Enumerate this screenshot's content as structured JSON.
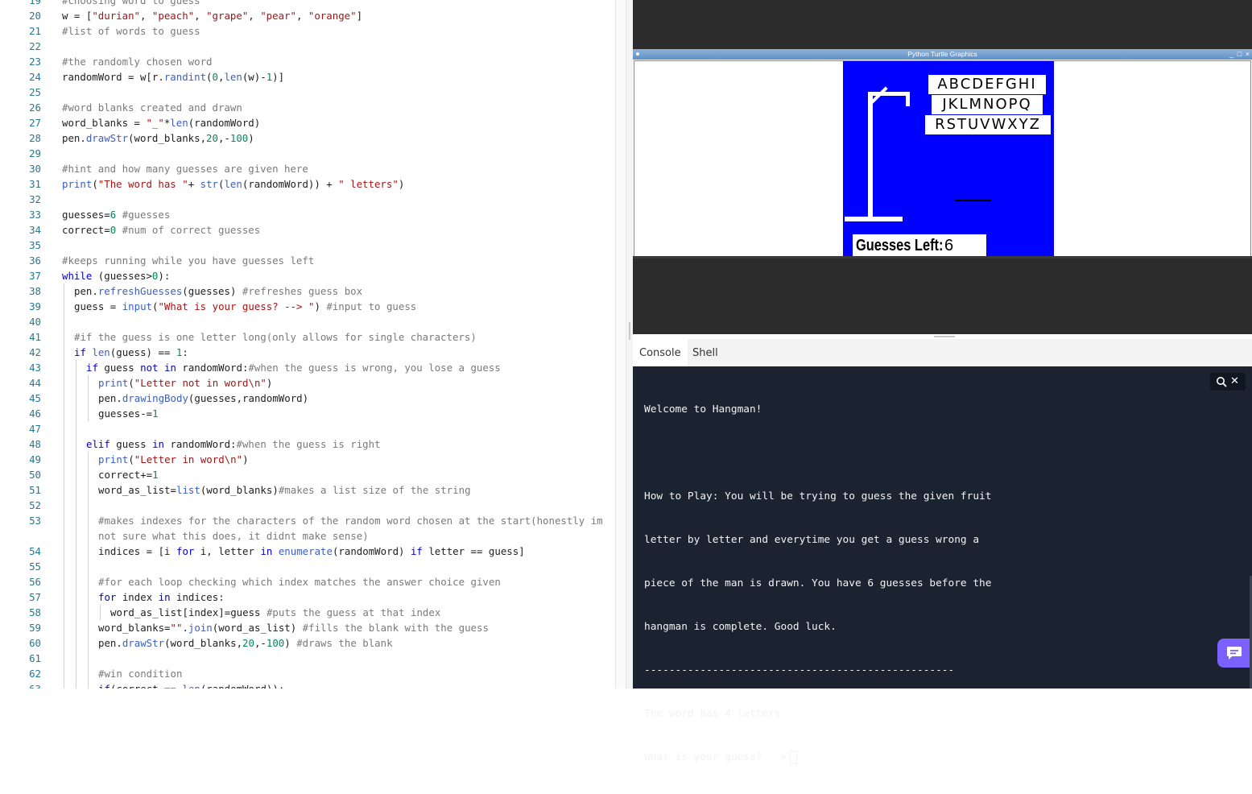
{
  "editor": {
    "lines": [
      {
        "num": "19",
        "indent": 0,
        "tokens": [
          {
            "t": "c",
            "v": "#choosing word to guess"
          }
        ]
      },
      {
        "num": "20",
        "indent": 0,
        "tokens": [
          {
            "t": "p",
            "v": "w = ["
          },
          {
            "t": "s",
            "v": "\"durian\""
          },
          {
            "t": "p",
            "v": ", "
          },
          {
            "t": "s",
            "v": "\"peach\""
          },
          {
            "t": "p",
            "v": ", "
          },
          {
            "t": "s",
            "v": "\"grape\""
          },
          {
            "t": "p",
            "v": ", "
          },
          {
            "t": "s",
            "v": "\"pear\""
          },
          {
            "t": "p",
            "v": ", "
          },
          {
            "t": "s",
            "v": "\"orange\""
          },
          {
            "t": "p",
            "v": "]"
          }
        ]
      },
      {
        "num": "21",
        "indent": 0,
        "tokens": [
          {
            "t": "c",
            "v": "#list of words to guess"
          }
        ]
      },
      {
        "num": "22",
        "indent": 0,
        "tokens": []
      },
      {
        "num": "23",
        "indent": 0,
        "tokens": [
          {
            "t": "c",
            "v": "#the randomly chosen word"
          }
        ]
      },
      {
        "num": "24",
        "indent": 0,
        "tokens": [
          {
            "t": "p",
            "v": "randomWord = w[r."
          },
          {
            "t": "b",
            "v": "randint"
          },
          {
            "t": "p",
            "v": "("
          },
          {
            "t": "n",
            "v": "0"
          },
          {
            "t": "p",
            "v": ","
          },
          {
            "t": "b",
            "v": "len"
          },
          {
            "t": "p",
            "v": "(w)-"
          },
          {
            "t": "n",
            "v": "1"
          },
          {
            "t": "p",
            "v": ")]"
          }
        ]
      },
      {
        "num": "25",
        "indent": 0,
        "tokens": []
      },
      {
        "num": "26",
        "indent": 0,
        "tokens": [
          {
            "t": "c",
            "v": "#word blanks created and drawn"
          }
        ]
      },
      {
        "num": "27",
        "indent": 0,
        "tokens": [
          {
            "t": "p",
            "v": "word_blanks = "
          },
          {
            "t": "s",
            "v": "\"_\""
          },
          {
            "t": "p",
            "v": "*"
          },
          {
            "t": "b",
            "v": "len"
          },
          {
            "t": "p",
            "v": "(randomWord)"
          }
        ]
      },
      {
        "num": "28",
        "indent": 0,
        "tokens": [
          {
            "t": "p",
            "v": "pen."
          },
          {
            "t": "b",
            "v": "drawStr"
          },
          {
            "t": "p",
            "v": "(word_blanks,"
          },
          {
            "t": "n",
            "v": "20"
          },
          {
            "t": "p",
            "v": ",-"
          },
          {
            "t": "n",
            "v": "100"
          },
          {
            "t": "p",
            "v": ")"
          }
        ]
      },
      {
        "num": "29",
        "indent": 0,
        "tokens": []
      },
      {
        "num": "30",
        "indent": 0,
        "tokens": [
          {
            "t": "c",
            "v": "#hint and how many guesses are given here"
          }
        ]
      },
      {
        "num": "31",
        "indent": 0,
        "tokens": [
          {
            "t": "b",
            "v": "print"
          },
          {
            "t": "p",
            "v": "("
          },
          {
            "t": "s",
            "v": "\"The word has \""
          },
          {
            "t": "p",
            "v": "+ "
          },
          {
            "t": "b",
            "v": "str"
          },
          {
            "t": "p",
            "v": "("
          },
          {
            "t": "b",
            "v": "len"
          },
          {
            "t": "p",
            "v": "(randomWord)) + "
          },
          {
            "t": "s",
            "v": "\" letters\""
          },
          {
            "t": "p",
            "v": ")"
          }
        ]
      },
      {
        "num": "32",
        "indent": 0,
        "tokens": []
      },
      {
        "num": "33",
        "indent": 0,
        "tokens": [
          {
            "t": "p",
            "v": "guesses="
          },
          {
            "t": "n",
            "v": "6"
          },
          {
            "t": "p",
            "v": " "
          },
          {
            "t": "c",
            "v": "#guesses"
          }
        ]
      },
      {
        "num": "34",
        "indent": 0,
        "tokens": [
          {
            "t": "p",
            "v": "correct="
          },
          {
            "t": "n",
            "v": "0"
          },
          {
            "t": "p",
            "v": " "
          },
          {
            "t": "c",
            "v": "#num of correct guesses"
          }
        ]
      },
      {
        "num": "35",
        "indent": 0,
        "tokens": []
      },
      {
        "num": "36",
        "indent": 0,
        "tokens": [
          {
            "t": "c",
            "v": "#keeps running while you have guesses left"
          }
        ]
      },
      {
        "num": "37",
        "indent": 0,
        "tokens": [
          {
            "t": "k",
            "v": "while"
          },
          {
            "t": "p",
            "v": " (guesses>"
          },
          {
            "t": "n",
            "v": "0"
          },
          {
            "t": "p",
            "v": "):"
          }
        ]
      },
      {
        "num": "38",
        "indent": 1,
        "tokens": [
          {
            "t": "p",
            "v": "pen."
          },
          {
            "t": "b",
            "v": "refreshGuesses"
          },
          {
            "t": "p",
            "v": "(guesses) "
          },
          {
            "t": "c",
            "v": "#refreshes guess box"
          }
        ]
      },
      {
        "num": "39",
        "indent": 1,
        "tokens": [
          {
            "t": "p",
            "v": "guess = "
          },
          {
            "t": "b",
            "v": "input"
          },
          {
            "t": "p",
            "v": "("
          },
          {
            "t": "s",
            "v": "\"What is your guess? --> \""
          },
          {
            "t": "p",
            "v": ") "
          },
          {
            "t": "c",
            "v": "#input to guess"
          }
        ]
      },
      {
        "num": "40",
        "indent": 1,
        "tokens": []
      },
      {
        "num": "41",
        "indent": 1,
        "tokens": [
          {
            "t": "c",
            "v": "#if the guess is one letter long(only allows for single characters)"
          }
        ]
      },
      {
        "num": "42",
        "indent": 1,
        "tokens": [
          {
            "t": "k",
            "v": "if"
          },
          {
            "t": "p",
            "v": " "
          },
          {
            "t": "b",
            "v": "len"
          },
          {
            "t": "p",
            "v": "(guess) == "
          },
          {
            "t": "n",
            "v": "1"
          },
          {
            "t": "p",
            "v": ":"
          }
        ]
      },
      {
        "num": "43",
        "indent": 2,
        "tokens": [
          {
            "t": "k",
            "v": "if"
          },
          {
            "t": "p",
            "v": " guess "
          },
          {
            "t": "k",
            "v": "not in"
          },
          {
            "t": "p",
            "v": " randomWord:"
          },
          {
            "t": "c",
            "v": "#when the guess is wrong, you lose a guess"
          }
        ]
      },
      {
        "num": "44",
        "indent": 3,
        "tokens": [
          {
            "t": "b",
            "v": "print"
          },
          {
            "t": "p",
            "v": "("
          },
          {
            "t": "s",
            "v": "\"Letter not in word\\n\""
          },
          {
            "t": "p",
            "v": ")"
          }
        ]
      },
      {
        "num": "45",
        "indent": 3,
        "tokens": [
          {
            "t": "p",
            "v": "pen."
          },
          {
            "t": "b",
            "v": "drawingBody"
          },
          {
            "t": "p",
            "v": "(guesses,randomWord)"
          }
        ]
      },
      {
        "num": "46",
        "indent": 3,
        "tokens": [
          {
            "t": "p",
            "v": "guesses-="
          },
          {
            "t": "n",
            "v": "1"
          }
        ]
      },
      {
        "num": "47",
        "indent": 2,
        "tokens": []
      },
      {
        "num": "48",
        "indent": 2,
        "tokens": [
          {
            "t": "k",
            "v": "elif"
          },
          {
            "t": "p",
            "v": " guess "
          },
          {
            "t": "k",
            "v": "in"
          },
          {
            "t": "p",
            "v": " randomWord:"
          },
          {
            "t": "c",
            "v": "#when the guess is right"
          }
        ]
      },
      {
        "num": "49",
        "indent": 3,
        "tokens": [
          {
            "t": "b",
            "v": "print"
          },
          {
            "t": "p",
            "v": "("
          },
          {
            "t": "s",
            "v": "\"Letter in word\\n\""
          },
          {
            "t": "p",
            "v": ")"
          }
        ]
      },
      {
        "num": "50",
        "indent": 3,
        "tokens": [
          {
            "t": "p",
            "v": "correct+="
          },
          {
            "t": "n",
            "v": "1"
          }
        ]
      },
      {
        "num": "51",
        "indent": 3,
        "tokens": [
          {
            "t": "p",
            "v": "word_as_list="
          },
          {
            "t": "b",
            "v": "list"
          },
          {
            "t": "p",
            "v": "(word_blanks)"
          },
          {
            "t": "c",
            "v": "#makes a list size of the string"
          }
        ]
      },
      {
        "num": "52",
        "indent": 3,
        "tokens": []
      },
      {
        "num": "53",
        "indent": 3,
        "wrapped": true,
        "tokens": [
          {
            "t": "c",
            "v": "#makes indexes for the characters of the random word chosen at the start(honestly im not sure what this does, it didnt make sense)"
          }
        ]
      },
      {
        "num": "54",
        "indent": 3,
        "tokens": [
          {
            "t": "p",
            "v": "indices = [i "
          },
          {
            "t": "k",
            "v": "for"
          },
          {
            "t": "p",
            "v": " i, letter "
          },
          {
            "t": "k",
            "v": "in"
          },
          {
            "t": "p",
            "v": " "
          },
          {
            "t": "b",
            "v": "enumerate"
          },
          {
            "t": "p",
            "v": "(randomWord) "
          },
          {
            "t": "k",
            "v": "if"
          },
          {
            "t": "p",
            "v": " letter == guess]"
          }
        ]
      },
      {
        "num": "55",
        "indent": 3,
        "tokens": []
      },
      {
        "num": "56",
        "indent": 3,
        "tokens": [
          {
            "t": "c",
            "v": "#for each loop checking which index matches the answer choice given"
          }
        ]
      },
      {
        "num": "57",
        "indent": 3,
        "tokens": [
          {
            "t": "k",
            "v": "for"
          },
          {
            "t": "p",
            "v": " index "
          },
          {
            "t": "k",
            "v": "in"
          },
          {
            "t": "p",
            "v": " indices:"
          }
        ]
      },
      {
        "num": "58",
        "indent": 4,
        "tokens": [
          {
            "t": "p",
            "v": "word_as_list[index]=guess "
          },
          {
            "t": "c",
            "v": "#puts the guess at that index"
          }
        ]
      },
      {
        "num": "59",
        "indent": 3,
        "tokens": [
          {
            "t": "p",
            "v": "word_blanks="
          },
          {
            "t": "s",
            "v": "\"\""
          },
          {
            "t": "p",
            "v": "."
          },
          {
            "t": "b",
            "v": "join"
          },
          {
            "t": "p",
            "v": "(word_as_list) "
          },
          {
            "t": "c",
            "v": "#fills the blank with the guess"
          }
        ]
      },
      {
        "num": "60",
        "indent": 3,
        "tokens": [
          {
            "t": "p",
            "v": "pen."
          },
          {
            "t": "b",
            "v": "drawStr"
          },
          {
            "t": "p",
            "v": "(word_blanks,"
          },
          {
            "t": "n",
            "v": "20"
          },
          {
            "t": "p",
            "v": ",-"
          },
          {
            "t": "n",
            "v": "100"
          },
          {
            "t": "p",
            "v": ") "
          },
          {
            "t": "c",
            "v": "#draws the blank"
          }
        ]
      },
      {
        "num": "61",
        "indent": 3,
        "tokens": []
      },
      {
        "num": "62",
        "indent": 3,
        "tokens": [
          {
            "t": "c",
            "v": "#win condition"
          }
        ]
      },
      {
        "num": "63",
        "indent": 3,
        "tokens": [
          {
            "t": "k",
            "v": "if"
          },
          {
            "t": "p",
            "v": "(correct == "
          },
          {
            "t": "b",
            "v": "len"
          },
          {
            "t": "p",
            "v": "(randomWord)):"
          }
        ]
      }
    ]
  },
  "turtle": {
    "title": "Python Turtle Graphics",
    "controls": "_ □ ×",
    "alphabet_rows": [
      "ABCDEFGHI",
      "JKLMNOPQ",
      "RSTUVWXYZ"
    ],
    "guesses_label": "Guesses Left:",
    "guesses_left": "6",
    "board_color": "#0000ff"
  },
  "console": {
    "tabs": [
      "Console",
      "Shell"
    ],
    "active_tab": "Console",
    "lines": [
      "Welcome to Hangman!",
      "",
      "How to Play: You will be trying to guess the given fruit",
      "letter by letter and everytime you get a guess wrong a",
      "piece of the man is drawn. You have 6 guesses before the",
      "hangman is complete. Good luck.",
      "--------------------------------------------------",
      "The word has 4 letters"
    ],
    "prompt": "What is your guess? -->",
    "background": "#1c2330"
  },
  "icons": {
    "search": "search-icon",
    "close": "close-icon",
    "chat": "chat-icon"
  },
  "colors": {
    "accent": "#7b61ff"
  }
}
